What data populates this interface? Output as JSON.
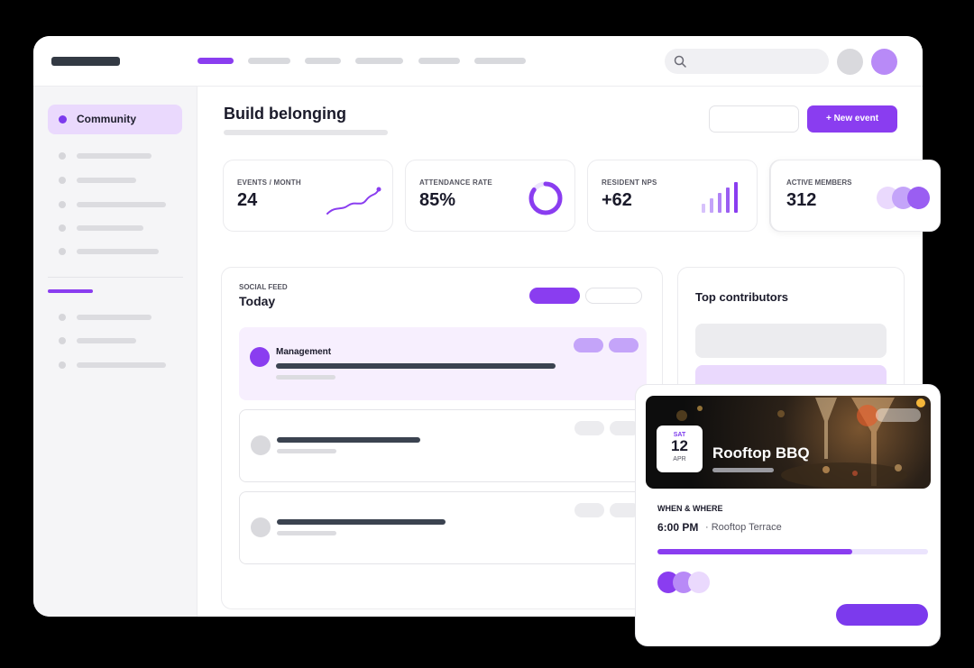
{
  "sidebar": {
    "active_item": {
      "label": "Community",
      "icon": "dot-icon"
    }
  },
  "main": {
    "title": "Build belonging",
    "new_event_label": "+ New event"
  },
  "stats": [
    {
      "label": "EVENTS / MONTH",
      "value": "24",
      "visual": "trend-line"
    },
    {
      "label": "ATTENDANCE RATE",
      "value": "85%",
      "visual": "donut",
      "fraction": 0.85
    },
    {
      "label": "RESIDENT NPS",
      "value": "+62",
      "visual": "bars"
    },
    {
      "label": "ACTIVE MEMBERS",
      "value": "312",
      "visual": "avatar-stack"
    }
  ],
  "feed": {
    "kicker": "SOCIAL FEED",
    "title": "Today",
    "posts": [
      {
        "name": "Management",
        "highlighted": true
      }
    ]
  },
  "contributors": {
    "title": "Top contributors"
  },
  "event": {
    "day_of_week": "SAT",
    "day": "12",
    "month": "APR",
    "title": "Rooftop BBQ",
    "when_where_label": "WHEN & WHERE",
    "time": "6:00 PM",
    "place": "· Rooftop Terrace",
    "progress": 0.72
  },
  "colors": {
    "accent": "#8a3df0",
    "accent_light": "#ead9fd",
    "text_dark": "#1a1a2a"
  }
}
